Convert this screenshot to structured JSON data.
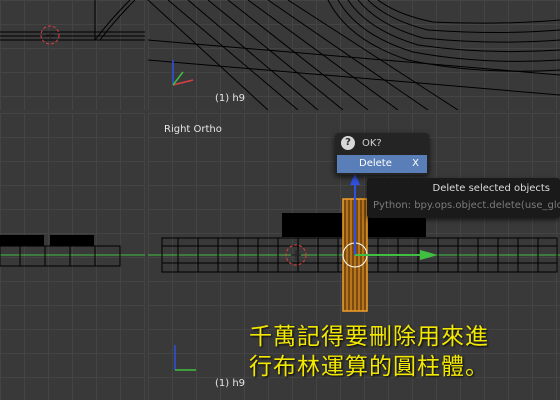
{
  "viewport_top": {
    "frame_label": "(1) h9"
  },
  "viewport_main": {
    "view_label": "Right Ortho",
    "frame_label": "(1) h9"
  },
  "popup": {
    "title": "OK?",
    "delete_label": "Delete",
    "shortcut": "X"
  },
  "tooltip": {
    "description": "Delete selected objects",
    "python": "Python: bpy.ops.object.delete(use_glo"
  },
  "subtitle": {
    "line1": "千萬記得要刪除用來進",
    "line2": "行布林運算的圓柱體。"
  },
  "colors": {
    "selection": "#f4a028",
    "x_axis": "#d84040",
    "y_axis": "#40c040",
    "z_axis": "#3050e0",
    "subtitle": "#f2e800"
  }
}
